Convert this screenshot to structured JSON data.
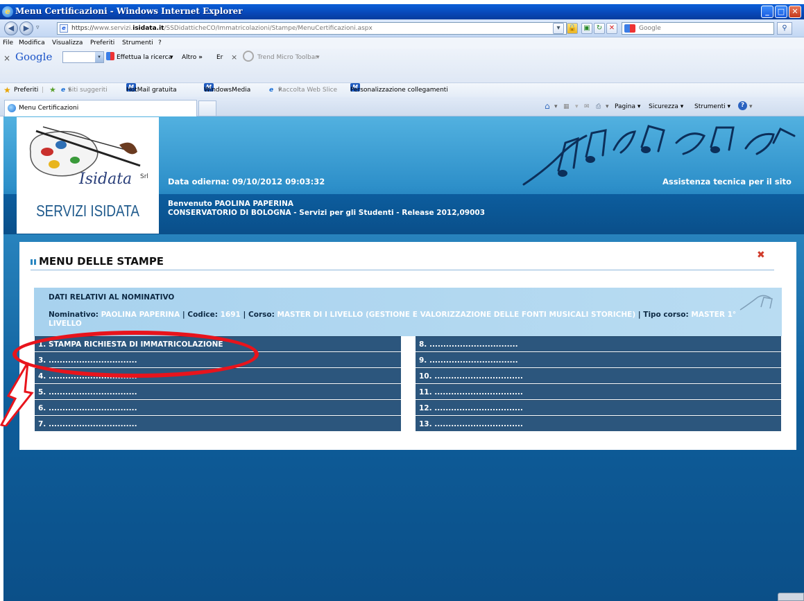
{
  "window": {
    "title": "Menu Certificazioni - Windows Internet Explorer"
  },
  "address": {
    "url_scheme": "https://",
    "url_pre": "www.servizi.",
    "url_domain": "isidata.it",
    "url_path": "/SSDidatticheCO/Immatricolazioni/Stampe/MenuCertificazioni.aspx",
    "search_placeholder": "Google"
  },
  "menubar": [
    "File",
    "Modifica",
    "Visualizza",
    "Preferiti",
    "Strumenti",
    "?"
  ],
  "google_toolbar": {
    "logo": "Google",
    "search_button": "Effettua la ricerca",
    "more": "Altro",
    "er": "Er",
    "trend": "Trend Micro Toolbar"
  },
  "favorites": {
    "preferiti": "Preferiti",
    "siti": "Siti suggeriti",
    "hotmail": "HotMail gratuita",
    "windowsmedia": "WindowsMedia",
    "webslice": "Raccolta Web Slice",
    "personalizza": "Personalizzazione collegamenti"
  },
  "tabs": {
    "active": "Menu Certificazioni",
    "commands": [
      "Pagina",
      "Sicurezza",
      "Strumenti"
    ]
  },
  "header": {
    "logo_brand": "Isidata",
    "logo_srl": "Srl",
    "logo_text": "SERVIZI ISIDATA",
    "date": "Data odierna: 09/10/2012 09:03:32",
    "assist": "Assistenza tecnica per il sito",
    "welcome": "Benvenuto PAOLINA PAPERINA",
    "institution": "CONSERVATORIO DI BOLOGNA - Servizi per gli Studenti - Release 2012,09003"
  },
  "panel": {
    "title": "MENU DELLE STAMPE",
    "info_title": "DATI RELATIVI AL NOMINATIVO",
    "nominativo_label": "Nominativo:",
    "nominativo_value": "PAOLINA PAPERINA",
    "codice_label": "Codice:",
    "codice_value": "1691",
    "corso_label": "Corso:",
    "corso_value": "MASTER DI I LIVELLO (GESTIONE E VALORIZZAZIONE DELLE FONTI MUSICALI STORICHE)",
    "tipo_label": "Tipo corso:",
    "tipo_value": "MASTER 1° LIVELLO"
  },
  "menu_left": [
    "1. STAMPA RICHIESTA DI IMMATRICOLAZIONE",
    "3. ................................",
    "4. ................................",
    "5. ................................",
    "6. ................................",
    "7. ................................"
  ],
  "menu_right": [
    "8. ................................",
    "9. ................................",
    "10. ................................",
    "11. ................................",
    "12. ................................",
    "13. ................................"
  ],
  "colors": {
    "row_bg": "#2c567d",
    "info_bg": "#a8d2ee",
    "annotation": "#e8141c",
    "header_blue": "#2d8fc9"
  }
}
